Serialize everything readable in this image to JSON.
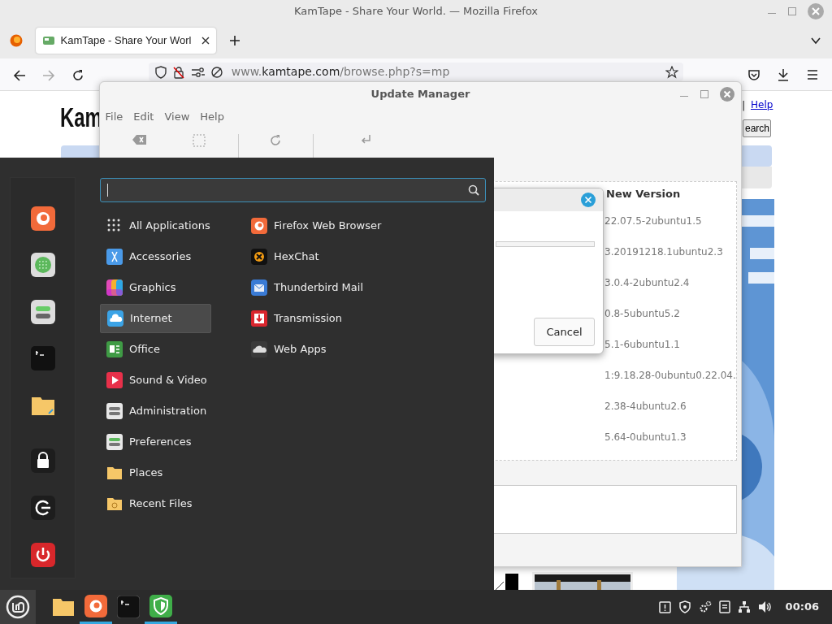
{
  "browser": {
    "window_title": "KamTape - Share Your World. — Mozilla Firefox",
    "tab": {
      "title": "KamTape - Share Your Worl",
      "selected": true
    },
    "url": {
      "prefix": "www.",
      "domain": "kamtape.com",
      "path": "/browse.php?s=mp"
    }
  },
  "web_page": {
    "logo": "Kam",
    "separator": "|",
    "help_link": "Help",
    "search_button": "earch"
  },
  "update_manager": {
    "title": "Update Manager",
    "menu": [
      "File",
      "Edit",
      "View",
      "Help"
    ],
    "column_header": "New Version",
    "versions": [
      "22.07.5-2ubuntu1.5",
      "3.20191218.1ubuntu2.3",
      "3.0.4-2ubuntu2.4",
      "0.8-5ubuntu5.2",
      "5.1-6ubuntu1.1",
      "1:9.18.28-0ubuntu0.22.04.",
      "2.38-4ubuntu2.6",
      "5.64-0ubuntu1.3"
    ],
    "dialog": {
      "progress": {
        "level": 0
      },
      "cancel_button": "Cancel"
    }
  },
  "app_menu": {
    "categories": [
      {
        "label": "All Applications",
        "selected": false
      },
      {
        "label": "Accessories",
        "selected": false
      },
      {
        "label": "Graphics",
        "selected": false
      },
      {
        "label": "Internet",
        "selected": true
      },
      {
        "label": "Office",
        "selected": false
      },
      {
        "label": "Sound & Video",
        "selected": false
      },
      {
        "label": "Administration",
        "selected": false
      },
      {
        "label": "Preferences",
        "selected": false
      },
      {
        "label": "Places",
        "selected": false
      },
      {
        "label": "Recent Files",
        "selected": false
      }
    ],
    "apps": [
      "Firefox Web Browser",
      "HexChat",
      "Thunderbird Mail",
      "Transmission",
      "Web Apps"
    ]
  },
  "taskbar": {
    "items": [
      {
        "running": false
      },
      {
        "running": true
      },
      {
        "running": false
      },
      {
        "running": true
      }
    ],
    "clock": "00:06"
  }
}
